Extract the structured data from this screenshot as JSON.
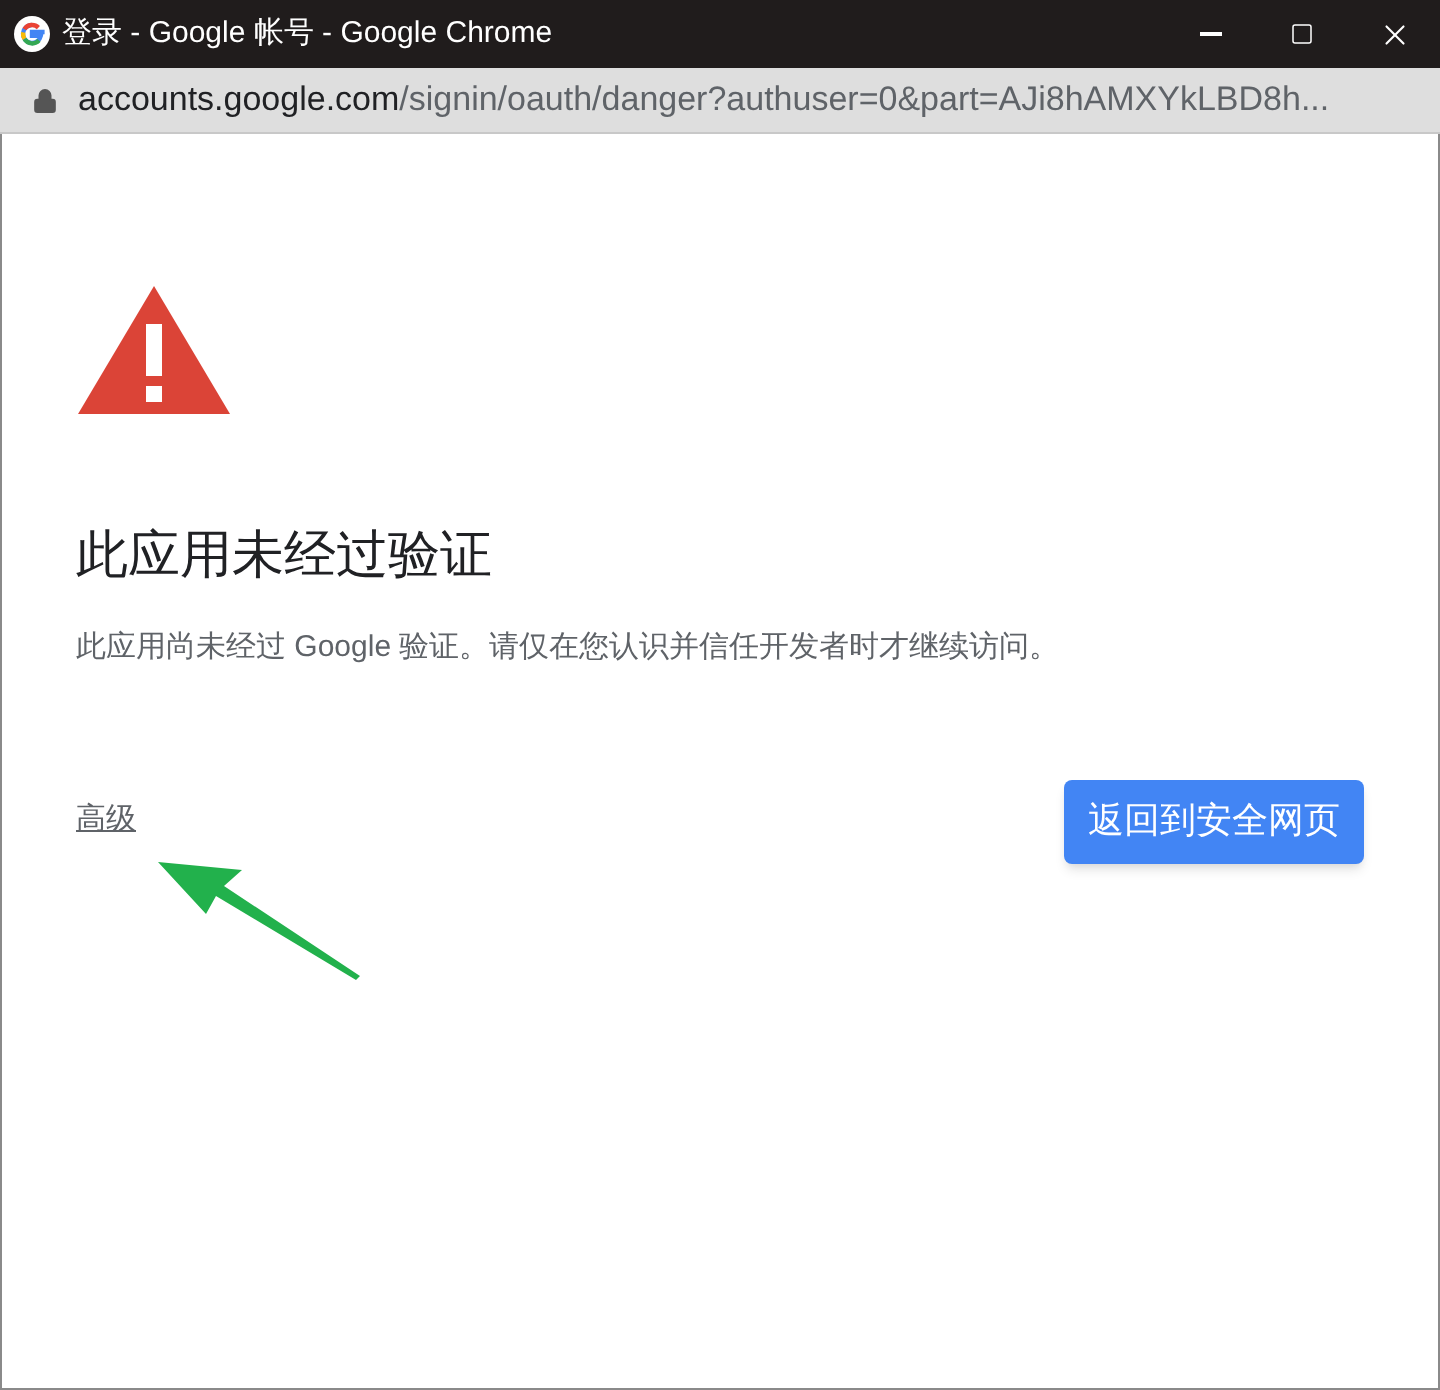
{
  "window": {
    "title": "登录 - Google 帐号 - Google Chrome"
  },
  "address_bar": {
    "host": "accounts.google.com",
    "path": "/signin/oauth/danger?authuser=0&part=AJi8hAMXYkLBD8h..."
  },
  "page": {
    "heading": "此应用未经过验证",
    "description": "此应用尚未经过 Google 验证。请仅在您认识并信任开发者时才继续访问。",
    "advanced_link": "高级",
    "back_button": "返回到安全网页"
  }
}
